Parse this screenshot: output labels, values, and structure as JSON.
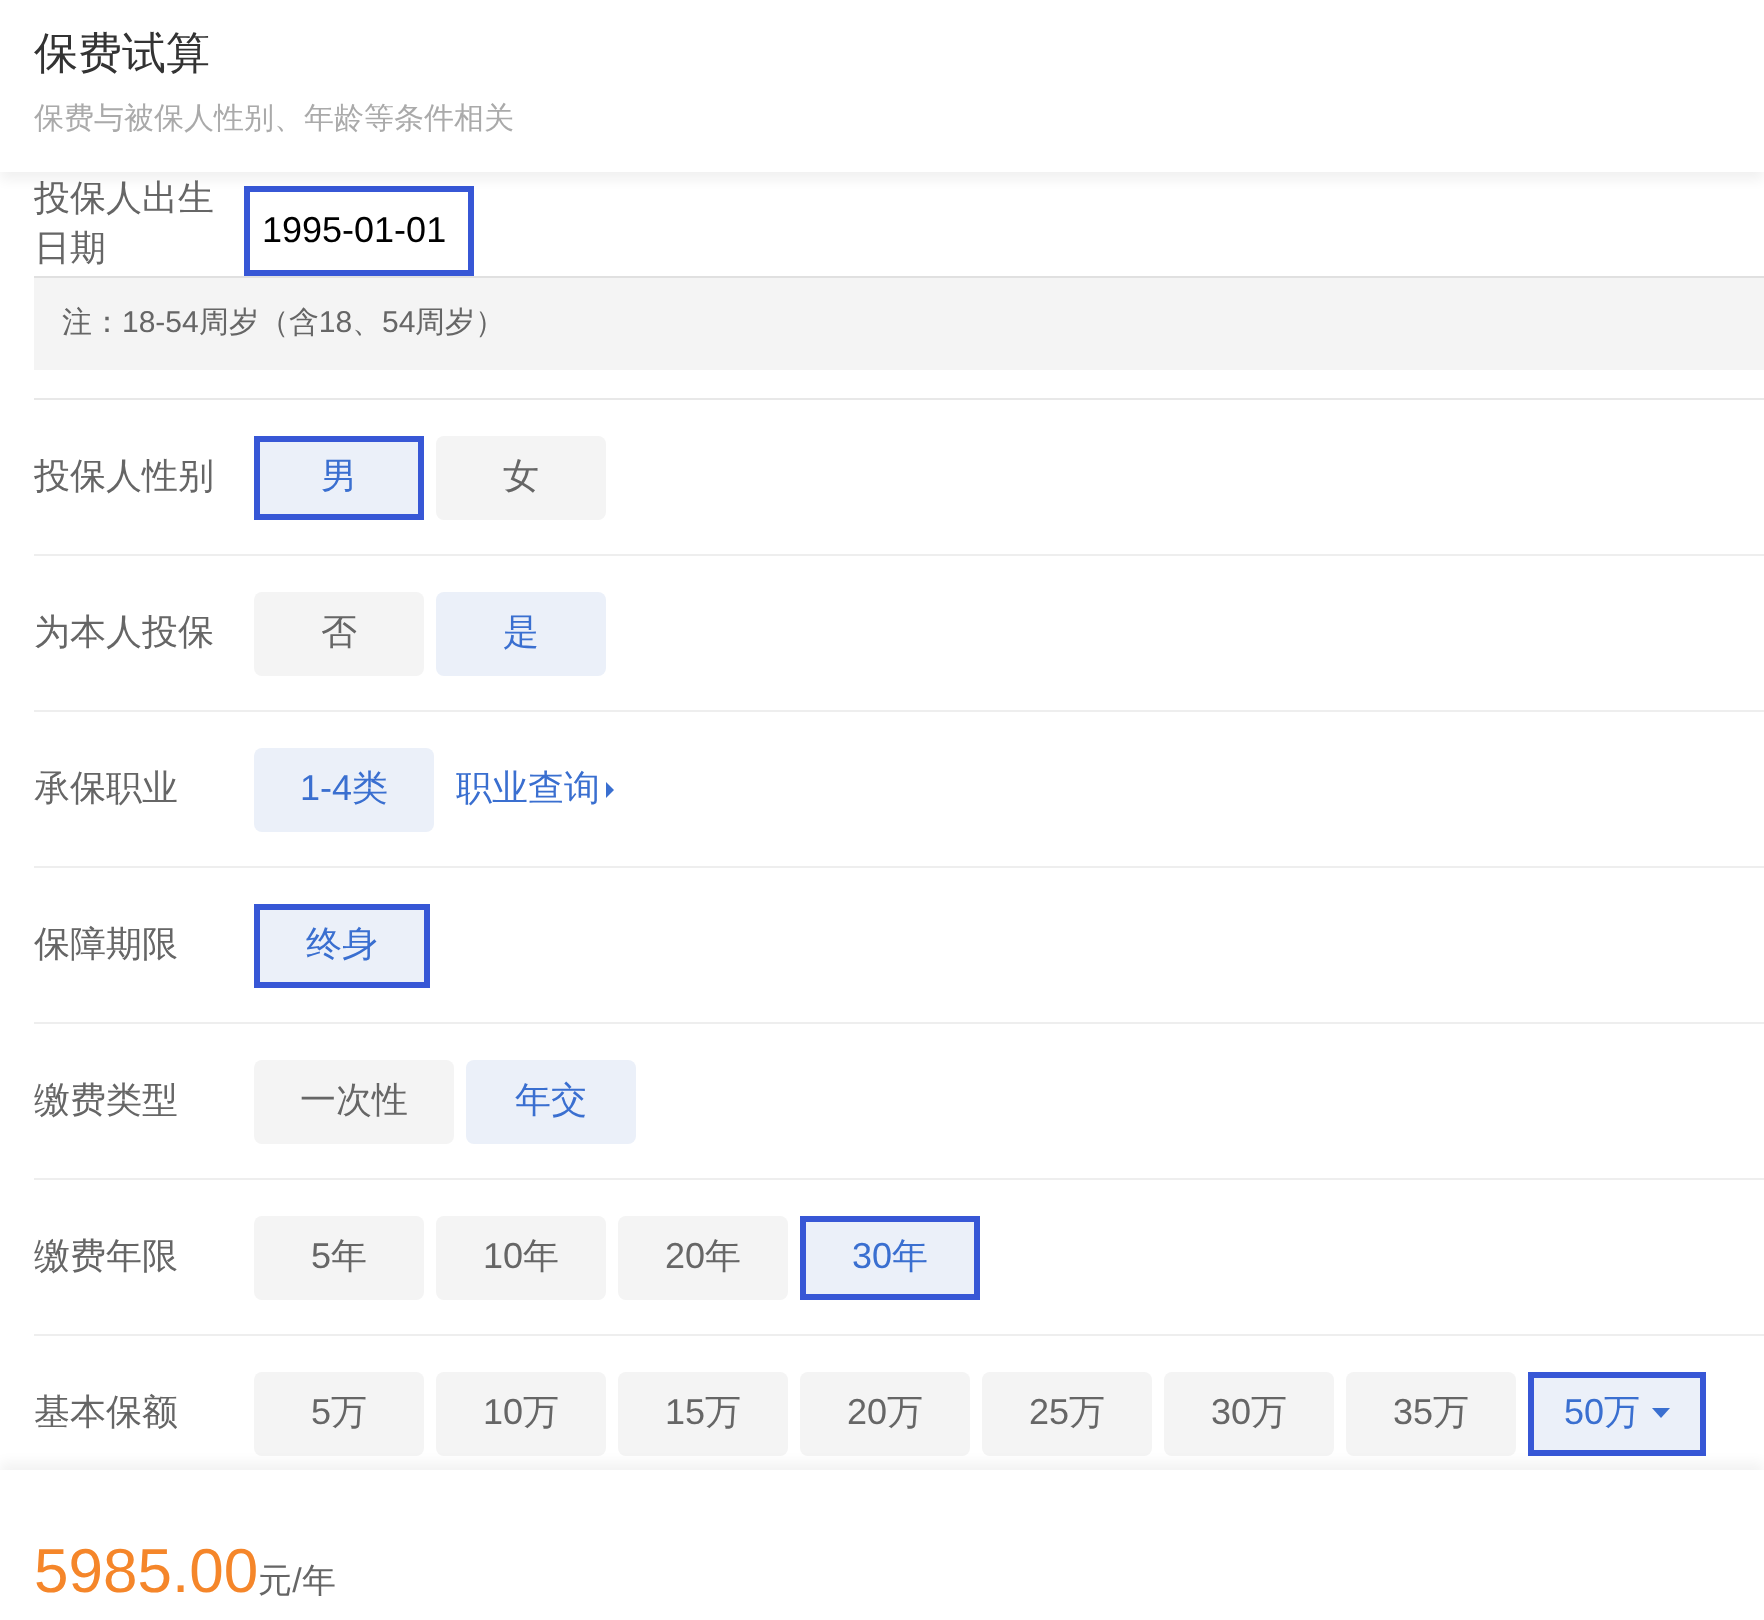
{
  "header": {
    "title": "保费试算",
    "subtitle": "保费与被保人性别、年龄等条件相关"
  },
  "birth_date": {
    "label": "投保人出生日期",
    "value": "1995-01-01",
    "focused": true,
    "note": "注：18-54周岁（含18、54周岁）"
  },
  "rows": [
    {
      "label": "投保人性别",
      "options": [
        {
          "label": "男",
          "selected": true,
          "focused": true
        },
        {
          "label": "女",
          "selected": false,
          "focused": false
        }
      ]
    },
    {
      "label": "为本人投保",
      "options": [
        {
          "label": "否",
          "selected": false,
          "focused": false
        },
        {
          "label": "是",
          "selected": true,
          "focused": false
        }
      ]
    },
    {
      "label": "承保职业",
      "options": [
        {
          "label": "1-4类",
          "selected": true,
          "focused": false
        }
      ],
      "link": "职业查询"
    },
    {
      "label": "保障期限",
      "options": [
        {
          "label": "终身",
          "selected": true,
          "focused": true
        }
      ]
    },
    {
      "label": "缴费类型",
      "options": [
        {
          "label": "一次性",
          "selected": false,
          "focused": false
        },
        {
          "label": "年交",
          "selected": true,
          "focused": false
        }
      ]
    },
    {
      "label": "缴费年限",
      "options": [
        {
          "label": "5年",
          "selected": false,
          "focused": false
        },
        {
          "label": "10年",
          "selected": false,
          "focused": false
        },
        {
          "label": "20年",
          "selected": false,
          "focused": false
        },
        {
          "label": "30年",
          "selected": true,
          "focused": true
        }
      ]
    },
    {
      "label": "基本保额",
      "options": [
        {
          "label": "5万",
          "selected": false,
          "focused": false
        },
        {
          "label": "10万",
          "selected": false,
          "focused": false
        },
        {
          "label": "15万",
          "selected": false,
          "focused": false
        },
        {
          "label": "20万",
          "selected": false,
          "focused": false
        },
        {
          "label": "25万",
          "selected": false,
          "focused": false
        },
        {
          "label": "30万",
          "selected": false,
          "focused": false
        },
        {
          "label": "35万",
          "selected": false,
          "focused": false
        }
      ],
      "dropdown": {
        "label": "50万",
        "selected": true,
        "focused": true
      }
    }
  ],
  "footer": {
    "price": "5985.00",
    "unit": "元/年"
  }
}
